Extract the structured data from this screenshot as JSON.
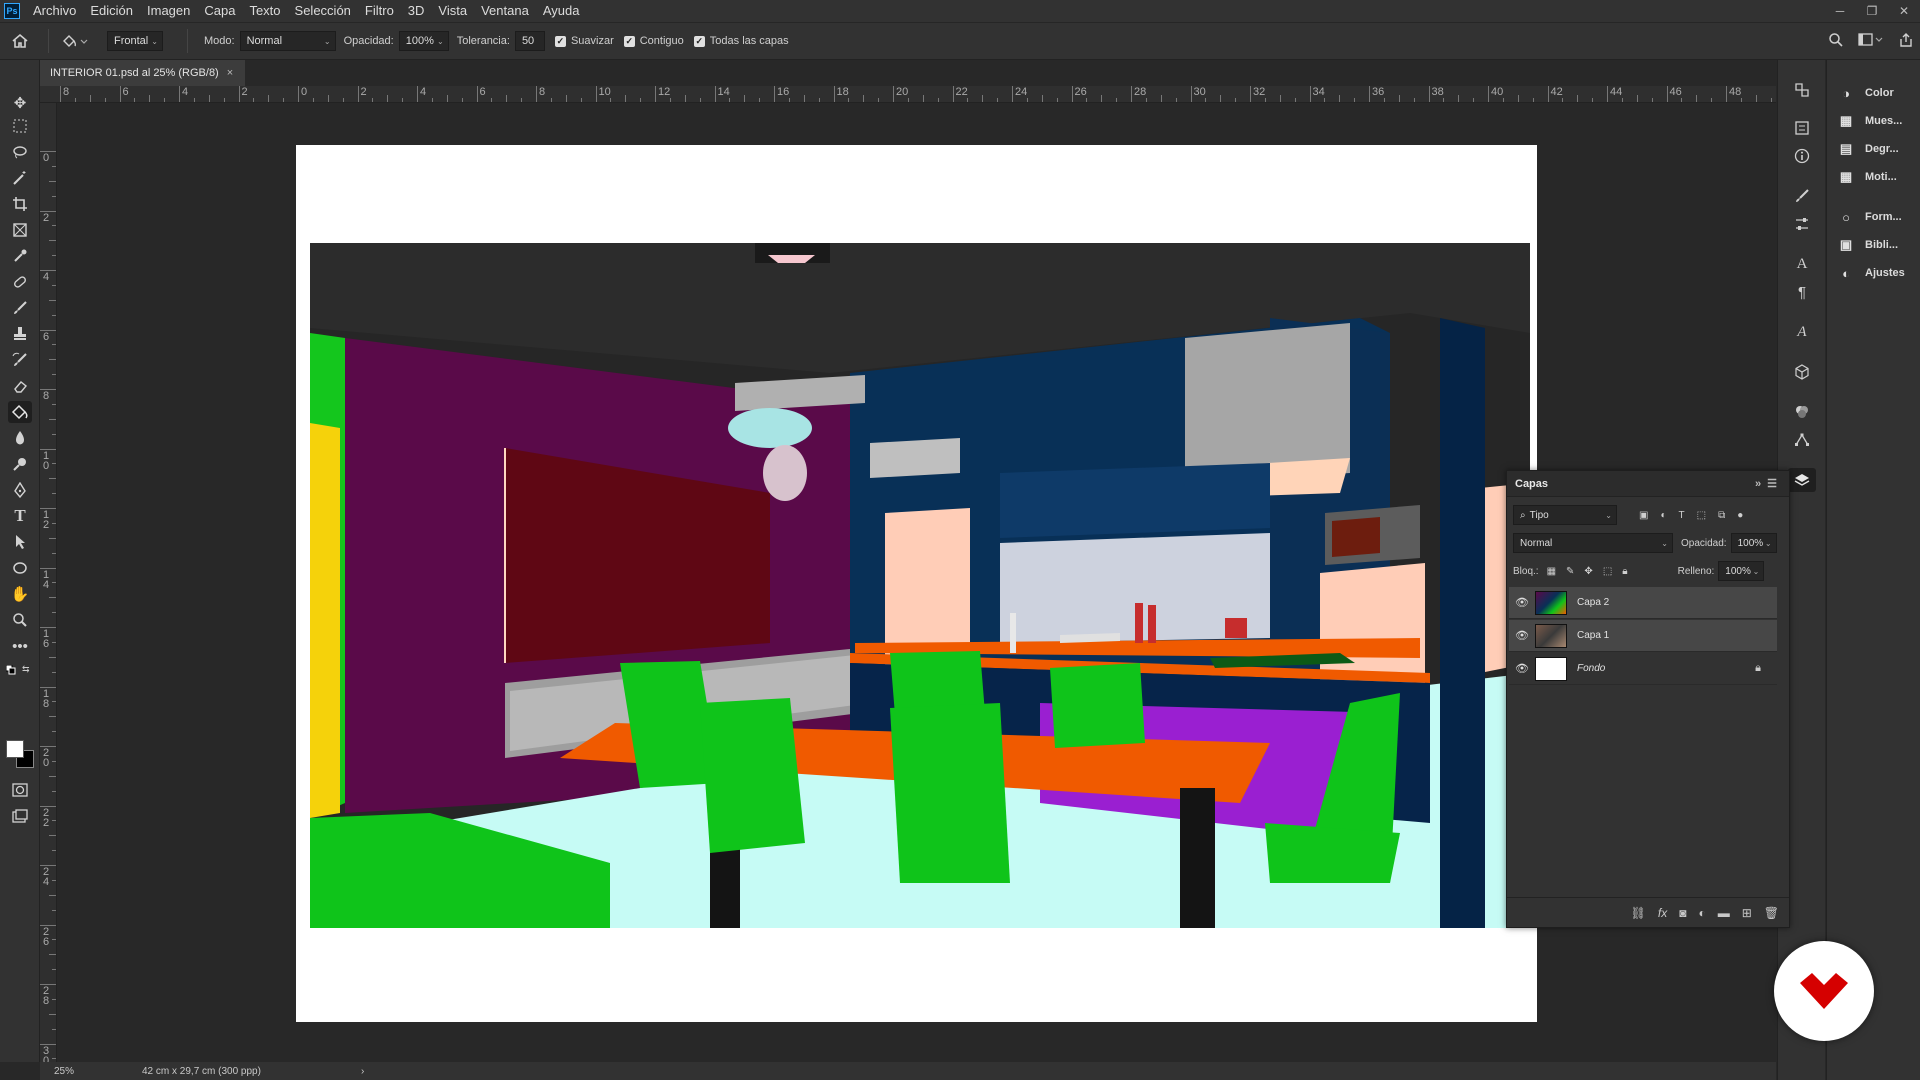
{
  "menu": {
    "items": [
      "Archivo",
      "Edición",
      "Imagen",
      "Capa",
      "Texto",
      "Selección",
      "Filtro",
      "3D",
      "Vista",
      "Ventana",
      "Ayuda"
    ],
    "logo": "Ps"
  },
  "window_controls": [
    "─",
    "❐",
    "✕"
  ],
  "options": {
    "sample_mode": "Frontal",
    "mode_label": "Modo:",
    "mode_value": "Normal",
    "opacity_label": "Opacidad:",
    "opacity_value": "100%",
    "tolerance_label": "Tolerancia:",
    "tolerance_value": "50",
    "smooth_label": "Suavizar",
    "contiguous_label": "Contiguo",
    "all_layers_label": "Todas las capas"
  },
  "document": {
    "tab_title": "INTERIOR 01.psd al 25% (RGB/8)",
    "close": "×"
  },
  "ruler": {
    "h_labels": [
      "8",
      "6",
      "4",
      "2",
      "0",
      "2",
      "4",
      "6",
      "8",
      "10",
      "12",
      "14",
      "16",
      "18",
      "20",
      "22",
      "24",
      "26",
      "28",
      "30",
      "32",
      "34",
      "36",
      "38",
      "40",
      "42",
      "44",
      "46",
      "48"
    ],
    "v_labels": [
      "0",
      "2",
      "4",
      "6",
      "8",
      "1\n0",
      "1\n2",
      "1\n4",
      "1\n6",
      "1\n8",
      "2\n0",
      "2\n2",
      "2\n4",
      "2\n6",
      "2\n8",
      "3\n0"
    ]
  },
  "status": {
    "zoom": "25%",
    "doc_size": "42 cm x 29,7 cm (300 ppp)",
    "arrow": "›"
  },
  "dock": {
    "items": [
      "Color",
      "Mues...",
      "Degr...",
      "Moti...",
      "Form...",
      "Bibli...",
      "Ajustes"
    ]
  },
  "layers_panel": {
    "title": "Capas",
    "filter_value": "Tipo",
    "blend_mode": "Normal",
    "opacity_label": "Opacidad:",
    "opacity_value": "100%",
    "lock_label": "Bloq.:",
    "fill_label": "Relleno:",
    "fill_value": "100%",
    "layers": [
      {
        "name": "Capa 2",
        "selected": true
      },
      {
        "name": "Capa 1",
        "selected": true
      },
      {
        "name": "Fondo",
        "selected": false,
        "locked": true
      }
    ]
  },
  "colors": {
    "ui_bg": "#323232",
    "canvas_bg": "#282828",
    "accent_red": "#d50000"
  }
}
